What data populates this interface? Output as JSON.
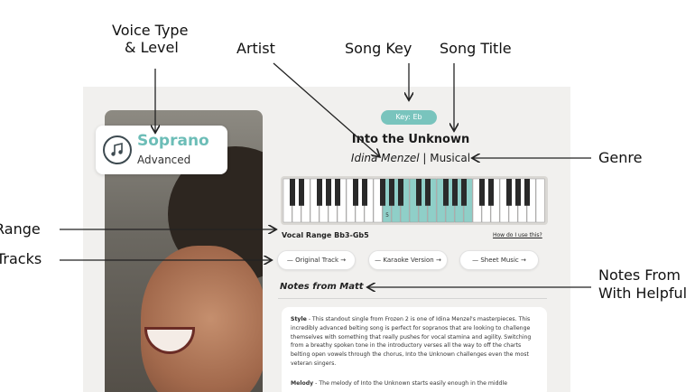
{
  "annotations": {
    "voice_type_line1": "Voice Type",
    "voice_type_line2": "& Level",
    "artist": "Artist",
    "song_key": "Song Key",
    "song_title": "Song Title",
    "genre": "Genre",
    "range": "Range",
    "tracks": "Tracks",
    "notes_line1": "Notes From",
    "notes_line2": "With Helpful"
  },
  "voice": {
    "type": "Soprano",
    "level": "Advanced",
    "icon": "music-note-icon"
  },
  "song": {
    "key_label": "Key: Eb",
    "title": "Into the Unknown",
    "artist": "Idina Menzel",
    "separator": " | ",
    "genre": "Musical"
  },
  "keyboard": {
    "highlight_color": "#8fcfc8",
    "marker": "5"
  },
  "vocal_range": {
    "label": "Vocal Range Bb3-Gb5",
    "help_link": "How do I use this?"
  },
  "tracks": [
    {
      "label": "Original Track",
      "icon": "arrow-right-icon"
    },
    {
      "label": "Karaoke Version",
      "icon": "arrow-right-icon"
    },
    {
      "label": "Sheet Music",
      "icon": "arrow-right-icon"
    }
  ],
  "notes": {
    "title": "Notes from Matt",
    "style_heading": "Style",
    "style_text": " - This standout single from Frozen 2 is one of Idina Menzel's masterpieces. This incredibly advanced belting song is perfect for sopranos that are looking to challenge themselves with something that really pushes for vocal stamina and agility. Switching from a breathy spoken tone in the introductory verses all the way to off the charts belting open vowels through the chorus, Into the Unknown challenges even the most veteran singers.",
    "melody_heading": "Melody",
    "melody_text": " - The melody of Into the Unknown starts easily enough in the middle"
  },
  "colors": {
    "accent": "#79c4bd",
    "page_bg": "#f1f0ee"
  }
}
